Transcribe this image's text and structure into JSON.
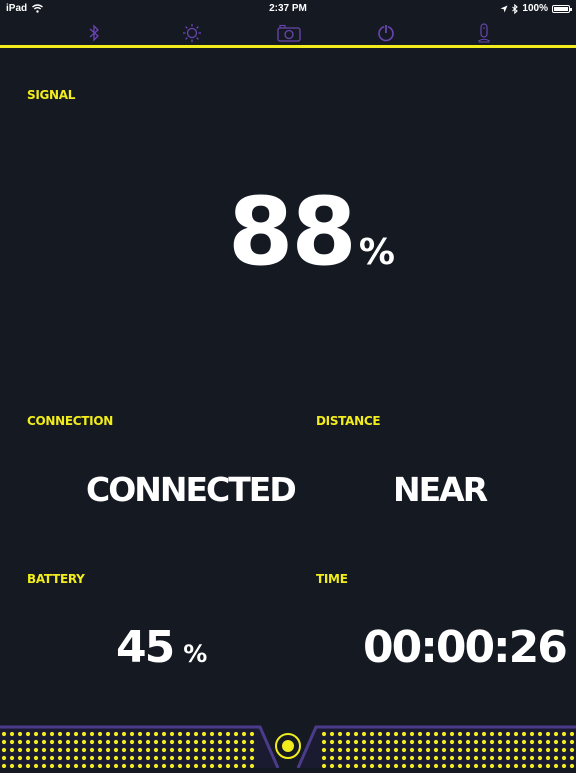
{
  "status_bar": {
    "device": "iPad",
    "time": "2:37 PM",
    "battery": "100%"
  },
  "tabs": [
    {
      "icon": "bluetooth-icon"
    },
    {
      "icon": "brightness-icon"
    },
    {
      "icon": "camera-icon"
    },
    {
      "icon": "power-icon"
    },
    {
      "icon": "tracker-icon"
    }
  ],
  "signal": {
    "label": "SIGNAL",
    "value": "88",
    "unit": "%"
  },
  "connection": {
    "label": "CONNECTION",
    "value": "CONNECTED"
  },
  "distance": {
    "label": "DISTANCE",
    "value": "NEAR"
  },
  "battery": {
    "label": "BATTERY",
    "value": "45",
    "unit": "%"
  },
  "time": {
    "label": "TIME",
    "value": "00:00:26"
  },
  "colors": {
    "accent": "#f2ec1c",
    "background": "#141922",
    "tab_icon": "#6a45b0",
    "footer_border": "#4c3b8a"
  }
}
